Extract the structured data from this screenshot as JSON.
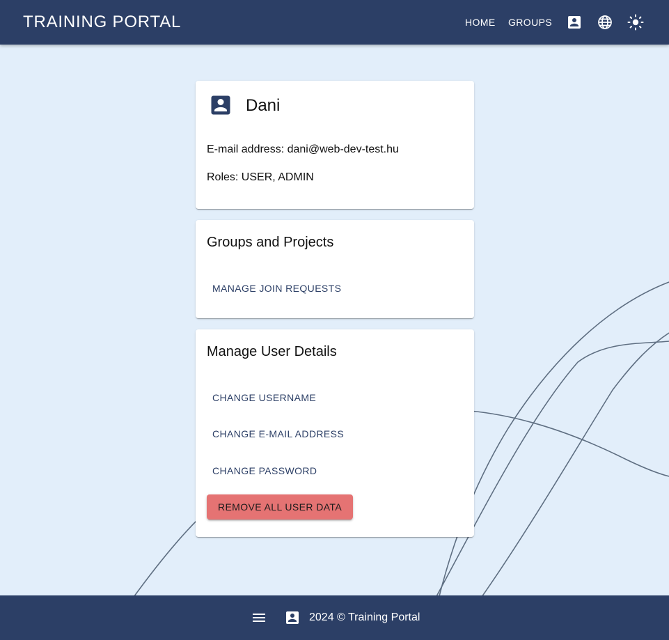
{
  "app": {
    "title": "TRAINING PORTAL"
  },
  "nav": {
    "home_label": "HOME",
    "groups_label": "GROUPS",
    "icons": [
      "account-box-icon",
      "language-globe-icon",
      "light-mode-sun-icon"
    ]
  },
  "profile": {
    "name": "Dani",
    "email_line": "E-mail address: dani@web-dev-test.hu",
    "roles_line": "Roles: USER, ADMIN"
  },
  "groups_card": {
    "title": "Groups and Projects",
    "manage_join_requests_label": "MANAGE JOIN REQUESTS"
  },
  "user_details_card": {
    "title": "Manage User Details",
    "change_username_label": "CHANGE USERNAME",
    "change_email_label": "CHANGE E-MAIL ADDRESS",
    "change_password_label": "CHANGE PASSWORD",
    "remove_data_label": "REMOVE ALL USER DATA"
  },
  "footer": {
    "text": "2024 © Training Portal",
    "icons": [
      "menu-icon",
      "account-box-icon"
    ]
  },
  "colors": {
    "primary": "#2c3f66",
    "background": "#e2eefa",
    "danger": "#e57373",
    "surface": "#ffffff"
  }
}
